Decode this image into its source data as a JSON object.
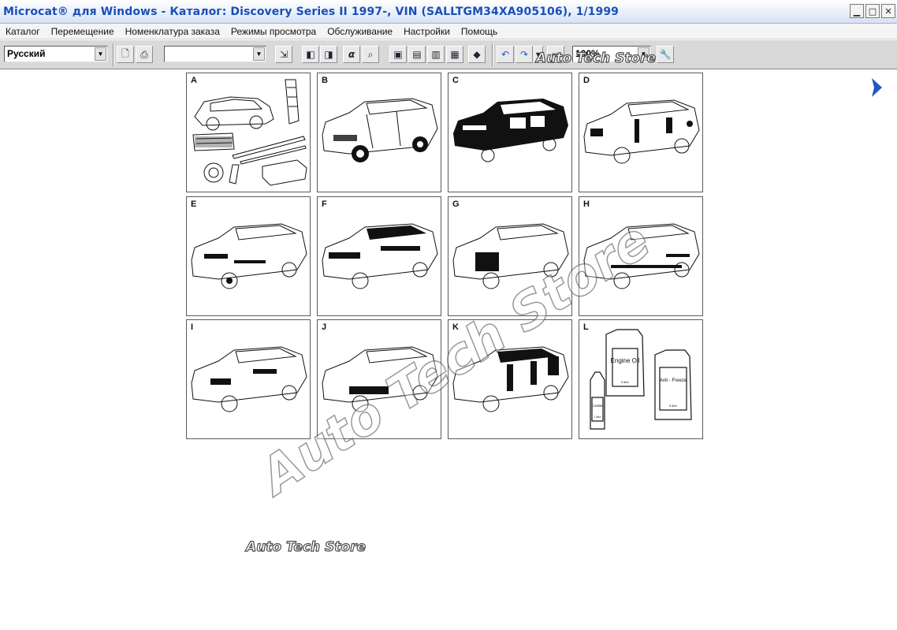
{
  "window": {
    "title": "Microcat® для Windows - Каталог: Discovery Series II 1997-, VIN (SALLTGM34XA905106), 1/1999",
    "controls": [
      "minimize",
      "maximize",
      "close"
    ]
  },
  "menu": [
    "Каталог",
    "Перемещение",
    "Номенклатура заказа",
    "Режимы просмотра",
    "Обслуживание",
    "Настройки",
    "Помощь"
  ],
  "toolbar": {
    "language": "Русский",
    "search_value": "",
    "zoom": "100%",
    "icons": [
      "preview-icon",
      "print-icon",
      "select-tool-icon",
      "cart-add-icon",
      "cart-icon",
      "alpha-search-icon",
      "magnifier-icon",
      "view-t1-icon",
      "view-t2-icon",
      "view-t3-icon",
      "view-t4-icon",
      "eraser-icon",
      "back-icon",
      "forward-icon",
      "history-dropdown-icon",
      "note-icon",
      "zoom-tool-icon"
    ]
  },
  "groups": [
    {
      "letter": "A",
      "type": "accessories"
    },
    {
      "letter": "B",
      "type": "car"
    },
    {
      "letter": "C",
      "type": "car"
    },
    {
      "letter": "D",
      "type": "car"
    },
    {
      "letter": "E",
      "type": "car"
    },
    {
      "letter": "F",
      "type": "car"
    },
    {
      "letter": "G",
      "type": "car"
    },
    {
      "letter": "H",
      "type": "car"
    },
    {
      "letter": "I",
      "type": "car"
    },
    {
      "letter": "J",
      "type": "car"
    },
    {
      "letter": "K",
      "type": "car"
    },
    {
      "letter": "L",
      "type": "fluids"
    }
  ],
  "fluids": {
    "engine_oil": "Engine Oil",
    "engine_oil_volume": "5 litre",
    "coolant": "Coolant",
    "coolant_volume": "1 litre",
    "antifreeze": "Anti - Freeze",
    "antifreeze_volume": "5 litre"
  },
  "watermark": "Auto Tech Store",
  "colors": {
    "title_text": "#1a4fb8",
    "next_arrow": "#2255cc"
  }
}
